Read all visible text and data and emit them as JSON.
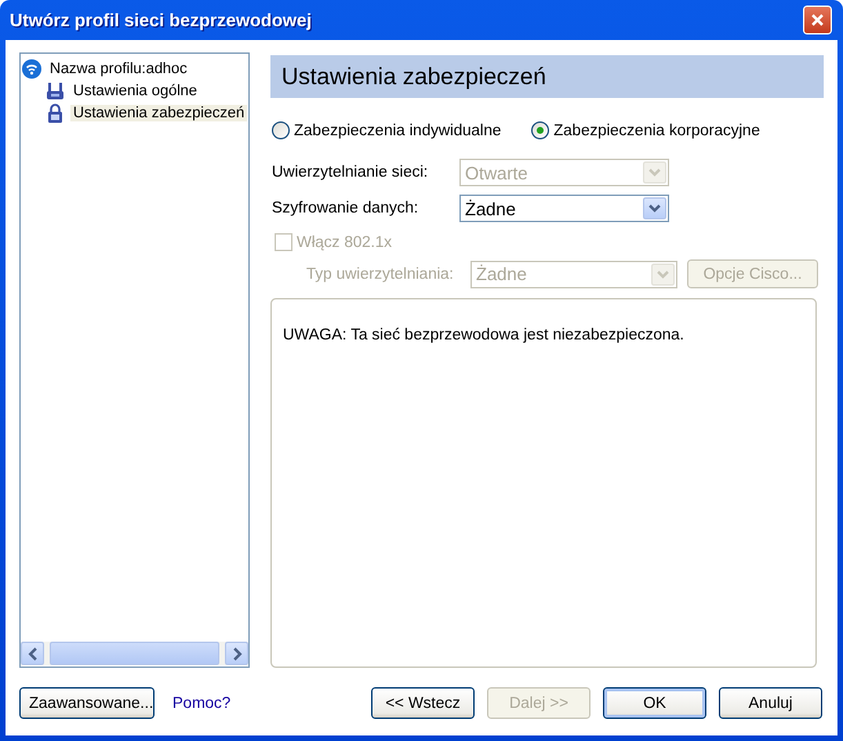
{
  "window": {
    "title": "Utwórz profil sieci bezprzewodowej"
  },
  "tree": {
    "items": [
      {
        "label": "Nazwa profilu:adhoc",
        "kind": "network",
        "selected": false,
        "children": [
          {
            "label": "Ustawienia ogólne",
            "kind": "general",
            "selected": false
          },
          {
            "label": "Ustawienia zabezpieczeń",
            "kind": "security",
            "selected": true
          }
        ]
      }
    ]
  },
  "panel": {
    "title": "Ustawienia zabezpieczeń"
  },
  "security_mode": [
    {
      "label": "Zabezpieczenia indywidualne",
      "selected": false
    },
    {
      "label": "Zabezpieczenia korporacyjne",
      "selected": true
    }
  ],
  "fields": [
    {
      "label": "Uwierzytelnianie sieci:",
      "value": "Otwarte",
      "disabled": true
    },
    {
      "label": "Szyfrowanie danych:",
      "value": "Żadne",
      "disabled": false
    }
  ],
  "enable_8021x": {
    "label": "Włącz 802.1x",
    "checked": false,
    "disabled": true
  },
  "auth_type": {
    "label": "Typ uwierzytelniania:",
    "value": "Żadne",
    "disabled": true
  },
  "cisco_button": {
    "label": "Opcje Cisco...",
    "disabled": true
  },
  "message": "UWAGA: Ta sieć bezprzewodowa jest niezabezpieczona.",
  "footer": {
    "advanced_button": {
      "label": "Zaawansowane...",
      "disabled": false
    },
    "help_link": "Pomoc?",
    "buttons": [
      {
        "label": "<< Wstecz",
        "disabled": false,
        "default": false
      },
      {
        "label": "Dalej >>",
        "disabled": true,
        "default": false
      },
      {
        "label": "OK",
        "disabled": false,
        "default": true
      },
      {
        "label": "Anuluj",
        "disabled": false,
        "default": false
      }
    ]
  }
}
